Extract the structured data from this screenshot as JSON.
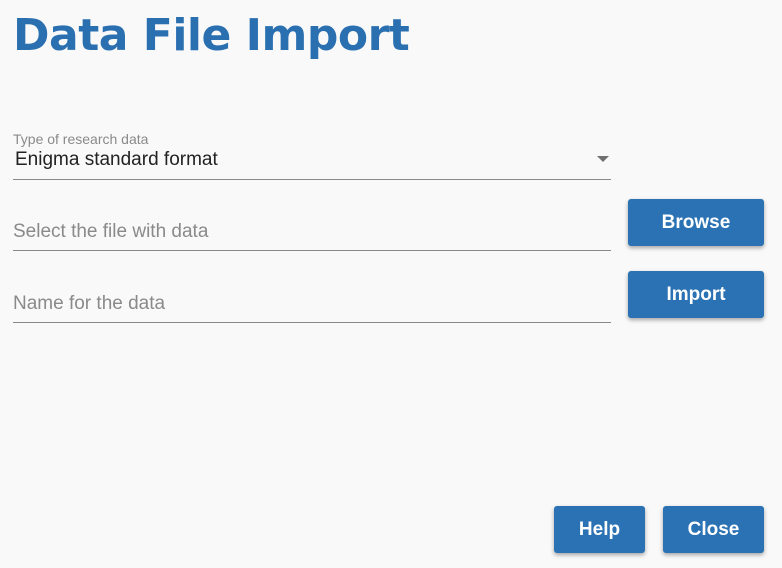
{
  "page": {
    "title": "Data File Import"
  },
  "form": {
    "data_type": {
      "caption": "Type of research data",
      "selected_value": "Enigma standard format"
    },
    "file_input": {
      "placeholder": "Select the file with data",
      "value": ""
    },
    "name_input": {
      "placeholder": "Name for the data",
      "value": ""
    }
  },
  "buttons": {
    "browse_label": "Browse",
    "import_label": "Import",
    "help_label": "Help",
    "close_label": "Close"
  },
  "icons": {
    "dropdown": "chevron-down-icon"
  },
  "colors": {
    "title": "#2a6fb0",
    "button_background": "#2a72b3",
    "button_text": "#ffffff",
    "page_background": "#f9f9f9"
  }
}
